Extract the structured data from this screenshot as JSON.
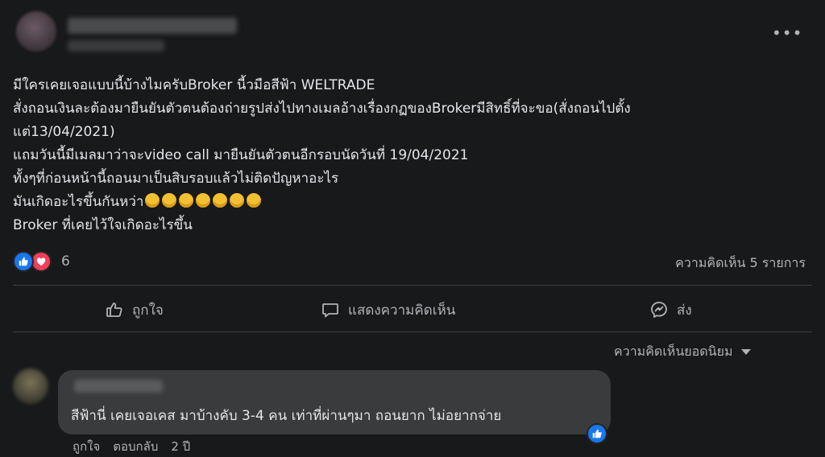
{
  "post": {
    "more_icon": "more-horizontal-icon",
    "text_lines": [
      "มีใครเคยเจอแบบนี้บ้างไมครับBroker นี้วมือสีฟ้า WELTRADE",
      "สั่งถอนเงินละต้องมายืนยันตัวตนต้องถ่ายรูปส่งไปทางเมลอ้างเรื่องกฏของBrokerมีสิทธิ์ที่จะขอ(สั่งถอนไปตั้ง",
      "แต่13/04/2021)",
      "แถมวันนี้มีเมลมาว่าจะvideo call มายืนยันตัวตนอีกรอบนัดวันที่ 19/04/2021",
      "ทั้งๆที่ก่อนหน้านี้ถอนมาเป็นสิบรอบแล้วไม่ติดปัญหาอะไร",
      "มันเกิดอะไรขึ้นกันหว่า",
      "Broker ที่เคยไว้ใจเกิดอะไรขึ้น"
    ],
    "emoji_count": 7
  },
  "stats": {
    "reaction_count": "6",
    "comments_label": "ความคิดเห็น 5 รายการ"
  },
  "actions": {
    "like": "ถูกใจ",
    "comment": "แสดงความคิดเห็น",
    "share": "ส่ง"
  },
  "sort": {
    "label": "ความคิดเห็นยอดนิยม"
  },
  "comment": {
    "text": "สีฟ้านี่ เคยเจอเคส มาบ้างคับ 3-4 คน เท่าที่ผ่านๆมา ถอนยาก ไม่อยากจ่าย",
    "like_label": "ถูกใจ",
    "reply_label": "ตอบกลับ",
    "time": "2 ปี"
  },
  "colors": {
    "background": "#18191a",
    "text": "#e4e6eb",
    "muted": "#b0b3b8",
    "like_blue": "#1877f2",
    "love_red": "#f33e58",
    "bubble": "#3a3b3c"
  }
}
